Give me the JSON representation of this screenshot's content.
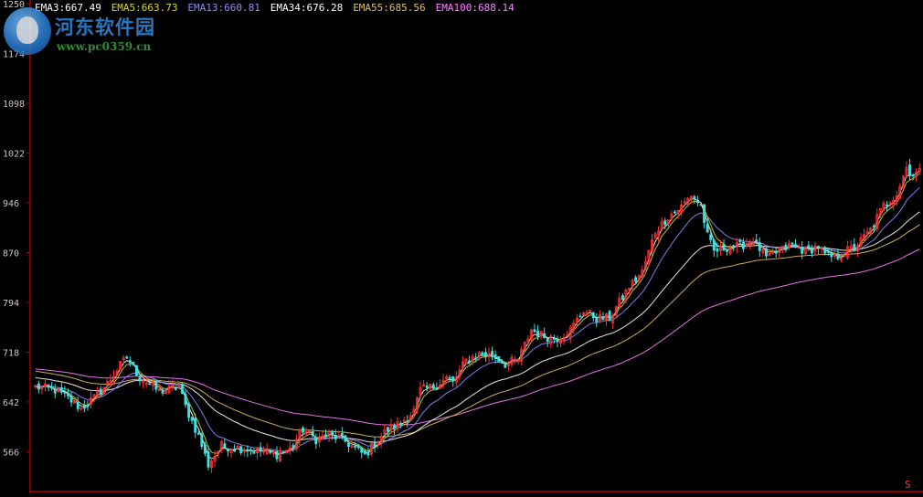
{
  "legend": [
    {
      "label": "EMA3:667.49",
      "color": "#ffffff"
    },
    {
      "label": "EMA5:663.73",
      "color": "#d8d820"
    },
    {
      "label": "EMA13:660.81",
      "color": "#8c8cff"
    },
    {
      "label": "EMA34:676.28",
      "color": "#ffffff"
    },
    {
      "label": "EMA55:685.56",
      "color": "#e0c060"
    },
    {
      "label": "EMA100:688.14",
      "color": "#ff80ff"
    }
  ],
  "watermark": {
    "title": "河东软件园",
    "url": "www.pc0359.cn"
  },
  "corner_mark": "S",
  "chart_data": {
    "type": "candlestick",
    "y_ticks": [
      "1250",
      "1174",
      "1098",
      "1022",
      "946",
      "870",
      "794",
      "718",
      "642",
      "566"
    ],
    "ylim": [
      508,
      1250
    ],
    "colors": {
      "up": "#ff3030",
      "down": "#40e0e0",
      "axis": "#b00000",
      "text": "#c8c8c8"
    },
    "anchors": [
      [
        0,
        665
      ],
      [
        6,
        660
      ],
      [
        10,
        648
      ],
      [
        14,
        632
      ],
      [
        18,
        648
      ],
      [
        22,
        670
      ],
      [
        26,
        698
      ],
      [
        28,
        710
      ],
      [
        32,
        680
      ],
      [
        38,
        658
      ],
      [
        44,
        665
      ],
      [
        46,
        635
      ],
      [
        50,
        590
      ],
      [
        53,
        546
      ],
      [
        57,
        575
      ],
      [
        62,
        572
      ],
      [
        68,
        568
      ],
      [
        74,
        562
      ],
      [
        78,
        570
      ],
      [
        82,
        600
      ],
      [
        86,
        585
      ],
      [
        90,
        592
      ],
      [
        94,
        585
      ],
      [
        98,
        572
      ],
      [
        101,
        560
      ],
      [
        104,
        580
      ],
      [
        108,
        600
      ],
      [
        112,
        610
      ],
      [
        116,
        628
      ],
      [
        118,
        660
      ],
      [
        122,
        665
      ],
      [
        126,
        678
      ],
      [
        128,
        672
      ],
      [
        132,
        705
      ],
      [
        136,
        715
      ],
      [
        140,
        713
      ],
      [
        144,
        700
      ],
      [
        148,
        706
      ],
      [
        152,
        752
      ],
      [
        156,
        742
      ],
      [
        160,
        740
      ],
      [
        164,
        752
      ],
      [
        168,
        782
      ],
      [
        172,
        770
      ],
      [
        176,
        770
      ],
      [
        182,
        818
      ],
      [
        186,
        840
      ],
      [
        190,
        902
      ],
      [
        194,
        925
      ],
      [
        198,
        940
      ],
      [
        201,
        958
      ],
      [
        204,
        942
      ],
      [
        206,
        895
      ],
      [
        208,
        872
      ],
      [
        212,
        878
      ],
      [
        216,
        880
      ],
      [
        220,
        890
      ],
      [
        224,
        862
      ],
      [
        228,
        872
      ],
      [
        232,
        882
      ],
      [
        236,
        872
      ],
      [
        240,
        880
      ],
      [
        242,
        866
      ],
      [
        245,
        862
      ],
      [
        248,
        870
      ],
      [
        252,
        882
      ],
      [
        256,
        905
      ],
      [
        260,
        942
      ],
      [
        264,
        960
      ],
      [
        267,
        1000
      ],
      [
        269,
        990
      ],
      [
        271,
        993
      ]
    ],
    "ema_start": {
      "EMA3": 665,
      "EMA5": 664,
      "EMA13": 667,
      "EMA34": 680,
      "EMA55": 690,
      "EMA100": 693
    },
    "ema_periods": {
      "EMA3": 3,
      "EMA5": 5,
      "EMA13": 13,
      "EMA34": 34,
      "EMA55": 55,
      "EMA100": 100
    },
    "candle_count": 272
  }
}
